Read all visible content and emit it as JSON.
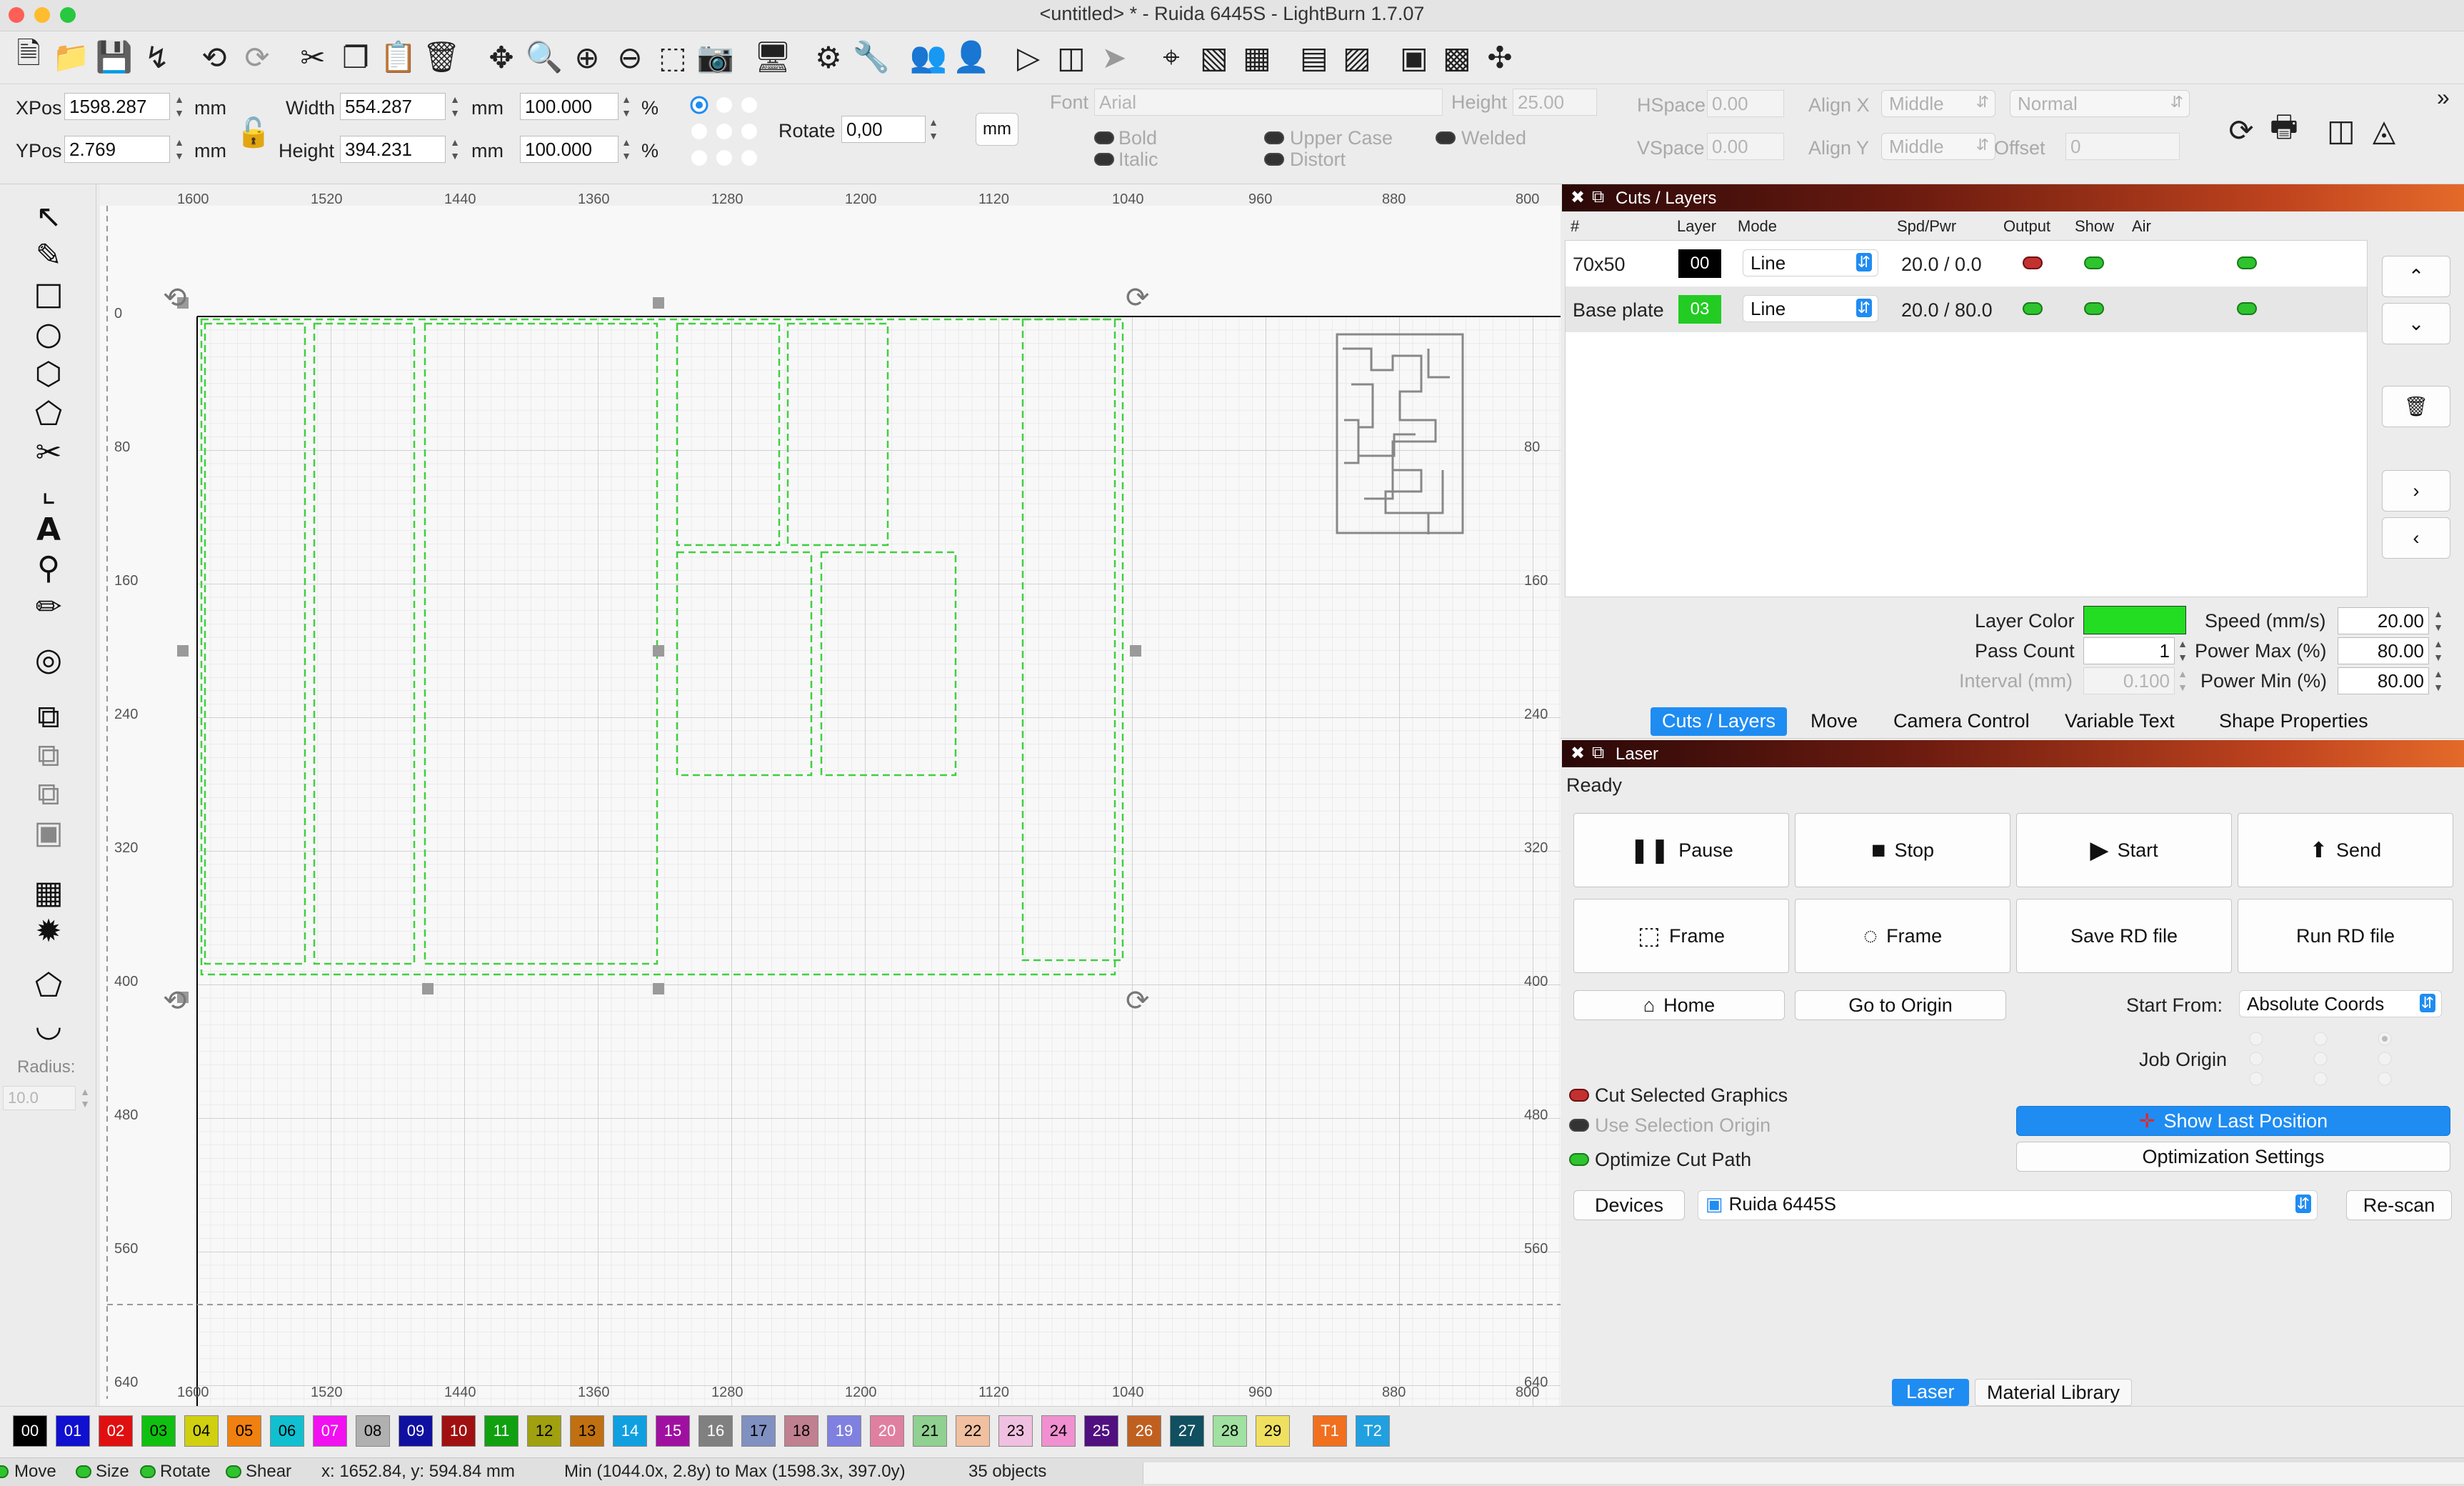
{
  "window": {
    "title": "<untitled> * - Ruida 6445S - LightBurn 1.7.07"
  },
  "toolbar_icons": [
    "new-file-icon",
    "open-file-icon",
    "save-icon",
    "import-icon",
    "undo-icon",
    "redo-icon",
    "cut-icon",
    "copy-icon",
    "paste-icon",
    "delete-icon",
    "move-icon",
    "zoom-fit-icon",
    "zoom-in-icon",
    "zoom-out-icon",
    "select-frame-icon",
    "camera-icon",
    "monitor-icon",
    "settings-icon",
    "tools-icon",
    "users-icon",
    "user-icon",
    "arrow-icon",
    "mirror-icon",
    "send-icon",
    "target-icon",
    "align-icon",
    "distribute-icon",
    "align-top-icon",
    "align-middle-icon",
    "align-bottom-icon",
    "align-left-icon",
    "center-icon"
  ],
  "numeric": {
    "xpos_label": "XPos",
    "xpos_value": "1598.287",
    "ypos_label": "YPos",
    "ypos_value": "2.769",
    "unit": "mm",
    "width_label": "Width",
    "width_value": "554.287",
    "height_label": "Height",
    "height_value": "394.231",
    "scale_w": "100.000",
    "scale_h": "100.000",
    "pct": "%",
    "rotate_label": "Rotate",
    "rotate_value": "0,00",
    "mm_button": "mm"
  },
  "text_tools": {
    "font_label": "Font",
    "font_value": "Arial",
    "height_label": "Height",
    "height_value": "25.00",
    "hspace_label": "HSpace",
    "hspace_value": "0.00",
    "vspace_label": "VSpace",
    "vspace_value": "0.00",
    "alignx_label": "Align X",
    "alignx_value": "Middle",
    "aligny_label": "Align Y",
    "aligny_value": "Middle",
    "style_value": "Normal",
    "offset_label": "Offset",
    "offset_value": "0",
    "bold": "Bold",
    "italic": "Italic",
    "upper": "Upper Case",
    "distort": "Distort",
    "welded": "Welded"
  },
  "left_tools": [
    "select-icon",
    "pen-icon",
    "rectangle-icon",
    "ellipse-icon",
    "polygon-icon",
    "node-edit-icon",
    "trim-icon",
    "position-icon",
    "text-icon",
    "marker-icon",
    "measure-icon",
    "offset-icon",
    "boolean-union-icon",
    "boolean-subtract-icon",
    "boolean-intersect-icon",
    "weld-icon",
    "grid-array-icon",
    "circular-array-icon",
    "fillet-icon",
    "chamfer-icon"
  ],
  "radius": {
    "label": "Radius:",
    "value": "10.0"
  },
  "ruler": {
    "top": [
      "1600",
      "1520",
      "1440",
      "1360",
      "1280",
      "1200",
      "1120",
      "1040",
      "960",
      "880",
      "800"
    ],
    "left": [
      "0",
      "80",
      "160",
      "240",
      "320",
      "400",
      "480",
      "560",
      "640"
    ],
    "right": [
      "80",
      "160",
      "240",
      "320",
      "400",
      "480",
      "560",
      "640"
    ],
    "bottom": [
      "1600",
      "1520",
      "1440",
      "1360",
      "1280",
      "1200",
      "1120",
      "1040",
      "960",
      "880",
      "800"
    ]
  },
  "cuts": {
    "panel_title": "Cuts / Layers",
    "headers": [
      "#",
      "Layer",
      "Mode",
      "Spd/Pwr",
      "Output",
      "Show",
      "Air"
    ],
    "rows": [
      {
        "name": "70x50",
        "layer": "00",
        "color": "#000000",
        "mode": "Line",
        "spdpwr": "20.0 / 0.0",
        "output": "off",
        "show": "on",
        "air": "on"
      },
      {
        "name": "Base plate",
        "layer": "03",
        "color": "#22cc22",
        "mode": "Line",
        "spdpwr": "20.0 / 80.0",
        "output": "on",
        "show": "on",
        "air": "on"
      }
    ],
    "layer_color_label": "Layer Color",
    "layer_color": "#22dd22",
    "speed_label": "Speed (mm/s)",
    "speed_value": "20.00",
    "pass_label": "Pass Count",
    "pass_value": "1",
    "powermax_label": "Power Max (%)",
    "powermax_value": "80.00",
    "interval_label": "Interval (mm)",
    "interval_value": "0.100",
    "powermin_label": "Power Min (%)",
    "powermin_value": "80.00",
    "tabs": [
      "Cuts / Layers",
      "Move",
      "Camera Control",
      "Variable Text",
      "Shape Properties"
    ]
  },
  "laser": {
    "panel_title": "Laser",
    "status": "Ready",
    "pause": "Pause",
    "stop": "Stop",
    "start": "Start",
    "send": "Send",
    "frame1": "Frame",
    "frame2": "Frame",
    "save_rd": "Save RD file",
    "run_rd": "Run RD file",
    "home": "Home",
    "go_origin": "Go to Origin",
    "start_from_label": "Start From:",
    "start_from_value": "Absolute Coords",
    "job_origin_label": "Job Origin",
    "cut_selected": "Cut Selected Graphics",
    "use_selection_origin": "Use Selection Origin",
    "optimize": "Optimize Cut Path",
    "show_last": "Show Last Position",
    "opt_settings": "Optimization Settings",
    "devices": "Devices",
    "device_value": "Ruida 6445S",
    "rescan": "Re-scan",
    "tabs": [
      "Laser",
      "Material Library"
    ]
  },
  "palette": [
    {
      "n": "00",
      "c": "#000000",
      "t": "#ffffff"
    },
    {
      "n": "01",
      "c": "#1010d0",
      "t": "#ffffff"
    },
    {
      "n": "02",
      "c": "#e01010",
      "t": "#ffffff"
    },
    {
      "n": "03",
      "c": "#10c010",
      "t": "#000000"
    },
    {
      "n": "04",
      "c": "#d0d010",
      "t": "#000000"
    },
    {
      "n": "05",
      "c": "#f08010",
      "t": "#000000"
    },
    {
      "n": "06",
      "c": "#10c0d0",
      "t": "#000000"
    },
    {
      "n": "07",
      "c": "#f010f0",
      "t": "#ffffff"
    },
    {
      "n": "08",
      "c": "#b0b0b0",
      "t": "#000000"
    },
    {
      "n": "09",
      "c": "#1010a0",
      "t": "#ffffff"
    },
    {
      "n": "10",
      "c": "#a01010",
      "t": "#ffffff"
    },
    {
      "n": "11",
      "c": "#10a010",
      "t": "#ffffff"
    },
    {
      "n": "12",
      "c": "#a0a010",
      "t": "#000000"
    },
    {
      "n": "13",
      "c": "#c07010",
      "t": "#000000"
    },
    {
      "n": "14",
      "c": "#10a0e0",
      "t": "#ffffff"
    },
    {
      "n": "15",
      "c": "#a010a0",
      "t": "#ffffff"
    },
    {
      "n": "16",
      "c": "#808080",
      "t": "#ffffff"
    },
    {
      "n": "17",
      "c": "#8090c0",
      "t": "#000000"
    },
    {
      "n": "18",
      "c": "#c08090",
      "t": "#000000"
    },
    {
      "n": "19",
      "c": "#8080e0",
      "t": "#ffffff"
    },
    {
      "n": "20",
      "c": "#e080a0",
      "t": "#ffffff"
    },
    {
      "n": "21",
      "c": "#90d090",
      "t": "#000000"
    },
    {
      "n": "22",
      "c": "#f0c0a0",
      "t": "#000000"
    },
    {
      "n": "23",
      "c": "#f0c0e0",
      "t": "#000000"
    },
    {
      "n": "24",
      "c": "#f090d0",
      "t": "#000000"
    },
    {
      "n": "25",
      "c": "#501080",
      "t": "#ffffff"
    },
    {
      "n": "26",
      "c": "#c06020",
      "t": "#ffffff"
    },
    {
      "n": "27",
      "c": "#105060",
      "t": "#ffffff"
    },
    {
      "n": "28",
      "c": "#a0e0a0",
      "t": "#000000"
    },
    {
      "n": "29",
      "c": "#f0e060",
      "t": "#000000"
    },
    {
      "n": "T1",
      "c": "#f07020",
      "t": "#ffffff"
    },
    {
      "n": "T2",
      "c": "#20a0e0",
      "t": "#ffffff"
    }
  ],
  "status": {
    "move": "Move",
    "size": "Size",
    "rotate": "Rotate",
    "shear": "Shear",
    "coords": "x: 1652.84, y: 594.84 mm",
    "range": "Min (1044.0x, 2.8y) to Max (1598.3x, 397.0y)",
    "objects": "35 objects"
  }
}
